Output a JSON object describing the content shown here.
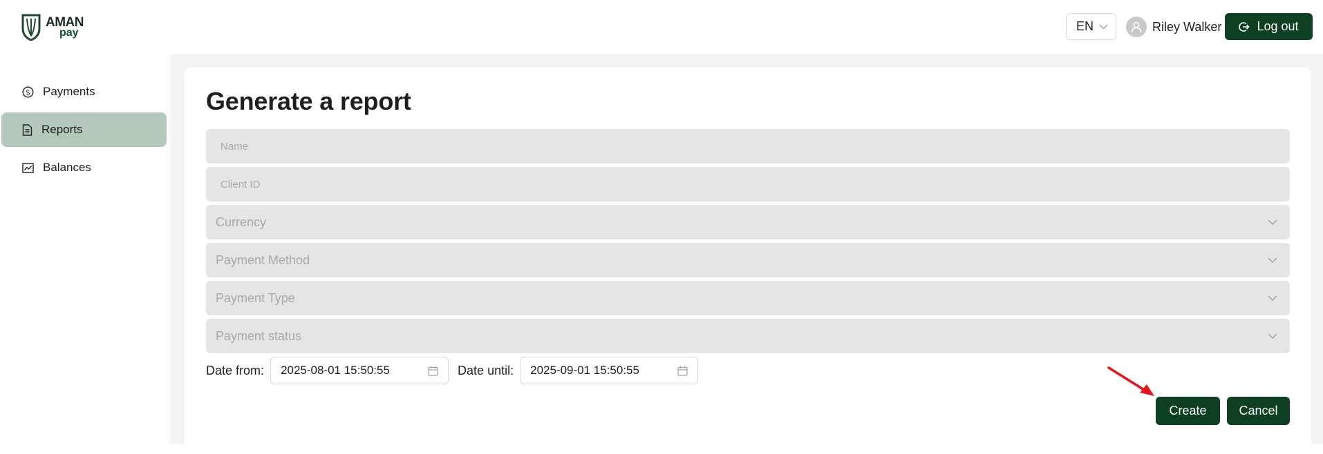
{
  "header": {
    "logo": {
      "line1": "AMAN",
      "line2": "pay"
    },
    "language": "EN",
    "user_name": "Riley Walker",
    "logout_label": "Log out"
  },
  "sidebar": {
    "items": [
      {
        "label": "Payments",
        "icon": "dollar-circle-icon"
      },
      {
        "label": "Reports",
        "icon": "document-icon",
        "active": true
      },
      {
        "label": "Balances",
        "icon": "line-chart-icon"
      }
    ]
  },
  "form": {
    "title": "Generate a report",
    "name_placeholder": "Name",
    "client_id_placeholder": "Client ID",
    "currency_placeholder": "Currency",
    "payment_method_placeholder": "Payment Method",
    "payment_type_placeholder": "Payment Type",
    "payment_status_placeholder": "Payment status",
    "date_from_label": "Date from",
    "date_from_value": "2025-08-01 15:50:55",
    "date_until_label": "Date until",
    "date_until_value": "2025-09-01 15:50:55",
    "create_label": "Create",
    "cancel_label": "Cancel"
  },
  "colors": {
    "brand": "#0d3f22",
    "active_nav": "#b3c8bb",
    "field_bg": "#e5e5e5",
    "annotation_arrow": "#e8141b"
  }
}
